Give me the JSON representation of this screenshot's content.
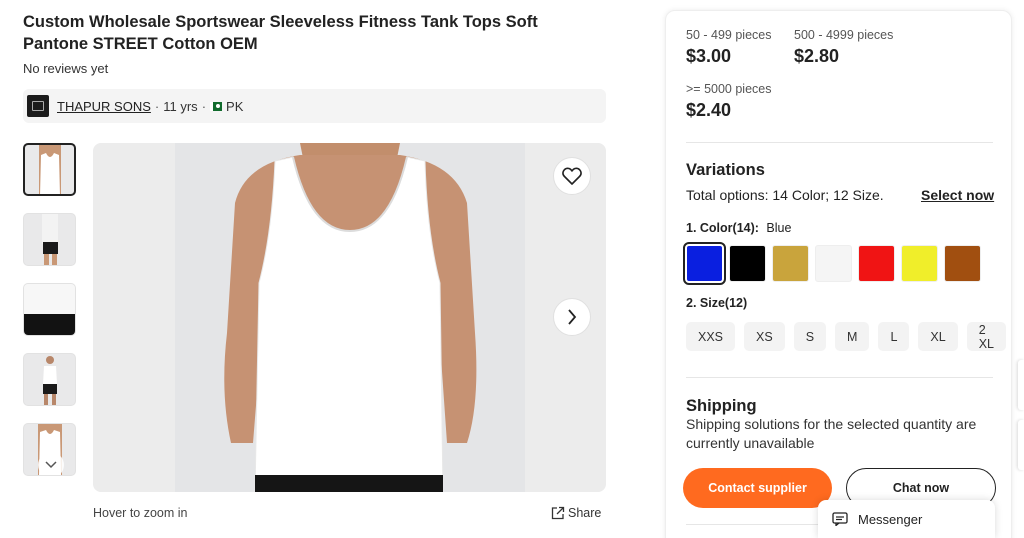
{
  "product": {
    "title": "Custom Wholesale Sportswear Sleeveless Fitness Tank Tops Soft Pantone STREET Cotton OEM",
    "reviews": "No reviews yet"
  },
  "supplier": {
    "name": "THAPUR SONS",
    "years": "11 yrs",
    "country": "PK"
  },
  "gallery": {
    "hover_hint": "Hover to zoom in",
    "share_label": "Share",
    "thumbnail_count": 5,
    "selected_index": 0
  },
  "pricing": {
    "tiers": [
      {
        "qty": "50 - 499 pieces",
        "price": "$3.00"
      },
      {
        "qty": "500 - 4999 pieces",
        "price": "$2.80"
      },
      {
        "qty": ">= 5000 pieces",
        "price": "$2.40"
      }
    ]
  },
  "variations": {
    "title": "Variations",
    "total_options": "Total options: 14 Color; 12 Size.",
    "select_now": "Select now",
    "color_label": "1. Color(14):",
    "color_selected": "Blue",
    "colors": [
      "#0a1fe0",
      "#000000",
      "#c9a43c",
      "#f5f5f5",
      "#f01414",
      "#f0ee2a",
      "#a14f10"
    ],
    "size_label": "2. Size(12)",
    "sizes": [
      "XXS",
      "XS",
      "S",
      "M",
      "L",
      "XL",
      "2 XL"
    ]
  },
  "shipping": {
    "title": "Shipping",
    "text": "Shipping solutions for the selected quantity are currently unavailable"
  },
  "actions": {
    "contact": "Contact supplier",
    "chat": "Chat now",
    "messenger": "Messenger"
  },
  "colors": {
    "accent": "#ff6a1f"
  }
}
